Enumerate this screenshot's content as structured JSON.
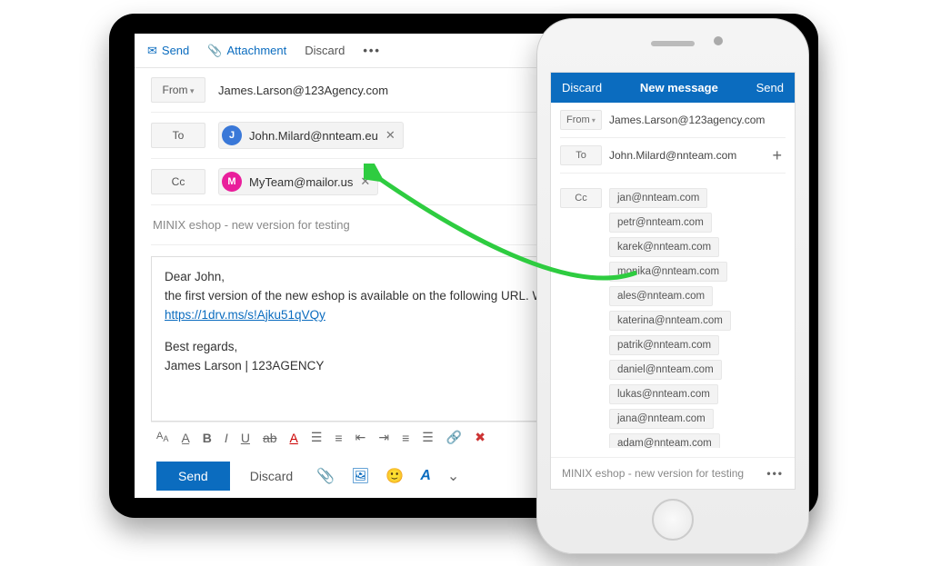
{
  "tablet": {
    "topbar": {
      "send": "Send",
      "attachment": "Attachment",
      "discard": "Discard"
    },
    "from": {
      "label": "From",
      "value": "James.Larson@123Agency.com"
    },
    "to": {
      "label": "To",
      "chip": {
        "initial": "J",
        "email": "John.Milard@nnteam.eu",
        "color": "#3a78d8"
      }
    },
    "cc": {
      "label": "Cc",
      "chip": {
        "initial": "M",
        "email": "MyTeam@mailor.us",
        "color": "#e91e9b"
      }
    },
    "subject": "MINIX eshop - new version for testing",
    "body": {
      "greeting": "Dear John,",
      "line1": "the first version of the new eshop is available on the following URL. We can discu",
      "link": "https://1drv.ms/s!Ajku51qVQy",
      "regards1": "Best regards,",
      "regards2": "James Larson | 123AGENCY"
    },
    "actions": {
      "send": "Send",
      "discard": "Discard"
    }
  },
  "phone": {
    "header": {
      "discard": "Discard",
      "title": "New message",
      "send": "Send"
    },
    "from": {
      "label": "From",
      "value": "James.Larson@123agency.com"
    },
    "to": {
      "label": "To",
      "value": "John.Milard@nnteam.com"
    },
    "cc": {
      "label": "Cc",
      "items": [
        "jan@nnteam.com",
        "petr@nnteam.com",
        "karek@nnteam.com",
        "monika@nnteam.com",
        "ales@nnteam.com",
        "katerina@nnteam.com",
        "patrik@nnteam.com",
        "daniel@nnteam.com",
        "lukas@nnteam.com",
        "jana@nnteam.com",
        "adam@nnteam.com"
      ]
    },
    "subject": "MINIX eshop - new version for testing"
  }
}
